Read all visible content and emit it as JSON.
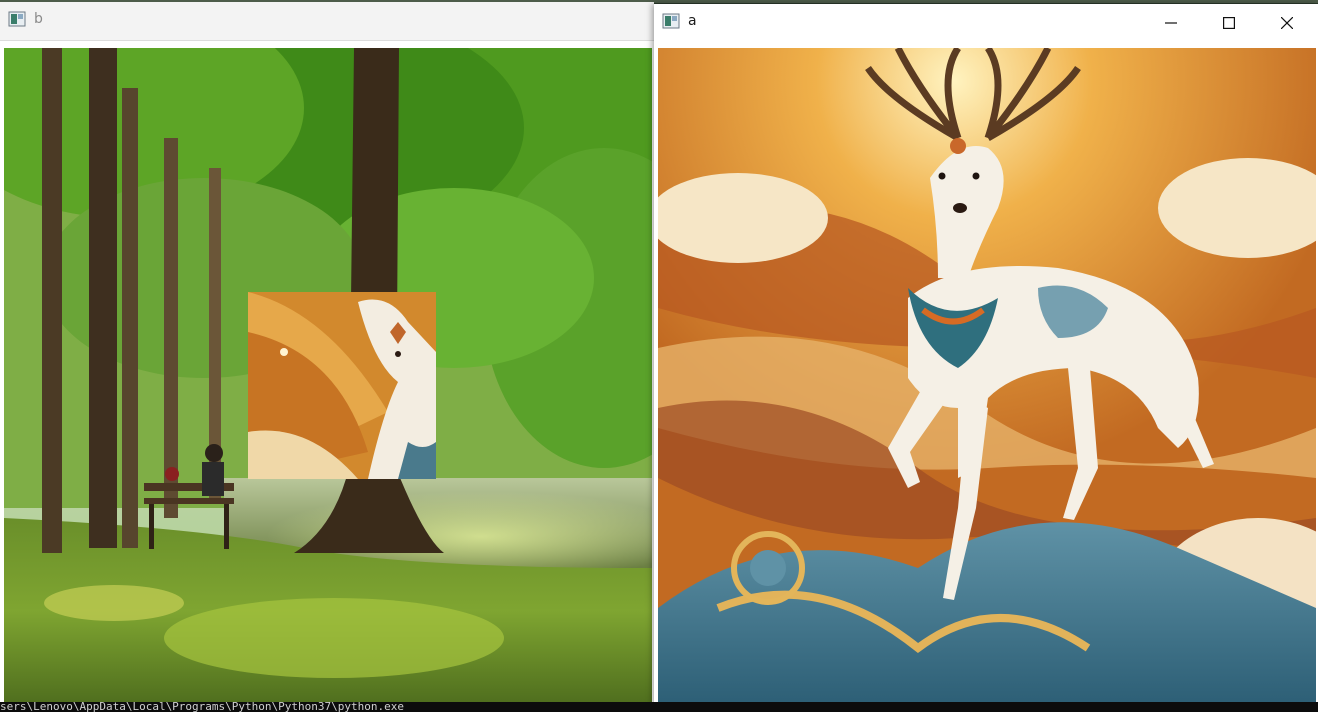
{
  "window_b": {
    "title": "b",
    "icon": "app-window-icon",
    "content": "forest-park-photo-with-pasted-deer-patch"
  },
  "window_a": {
    "title": "a",
    "icon": "app-window-icon",
    "controls": [
      "minimize-icon",
      "maximize-icon",
      "close-icon"
    ],
    "content": "golden-deer-illustration"
  },
  "console_text": "sers\\Lenovo\\AppData\\Local\\Programs\\Python\\Python37\\python.exe",
  "colors": {
    "titlebar_inactive": "#f3f3f3",
    "titlebar_active": "#ffffff",
    "forest_green": "#5e9c2a",
    "deer_orange": "#d98a2b"
  }
}
